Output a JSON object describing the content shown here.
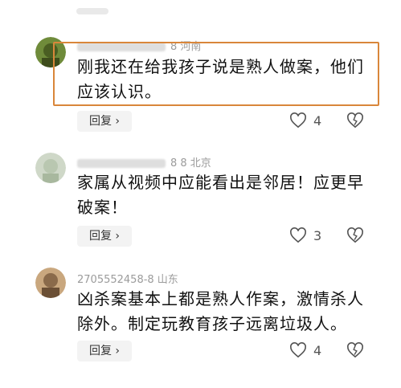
{
  "comments": [
    {
      "meta": "8 河南",
      "text_line1": "刚我还在给我孩子说是熟人做案，他们",
      "text_line2": "应该认识。",
      "reply_label": "回复 ›",
      "like_count": "4",
      "avatar_color": "#6f8b3a"
    },
    {
      "meta": "8 8 北京",
      "text_line1": "家属从视频中应能看出是邻居！应更早",
      "text_line2": "破案！",
      "reply_label": "回复 ›",
      "like_count": "3",
      "avatar_color": "#b9c7b0"
    },
    {
      "meta": "2705552458-8 山东",
      "text_line1": "凶杀案基本上都是熟人作案，激情杀人",
      "text_line2": "除外。制定玩教育孩子远离垃圾人。",
      "reply_label": "回复 ›",
      "like_count": "4",
      "avatar_color": "#8a6a4a"
    }
  ],
  "colors": {
    "highlight": "#d9863a",
    "meta": "#9b9b9b",
    "reply_bg": "#f3f3f3"
  },
  "icons": [
    "heart-outline-icon",
    "broken-heart-icon"
  ]
}
